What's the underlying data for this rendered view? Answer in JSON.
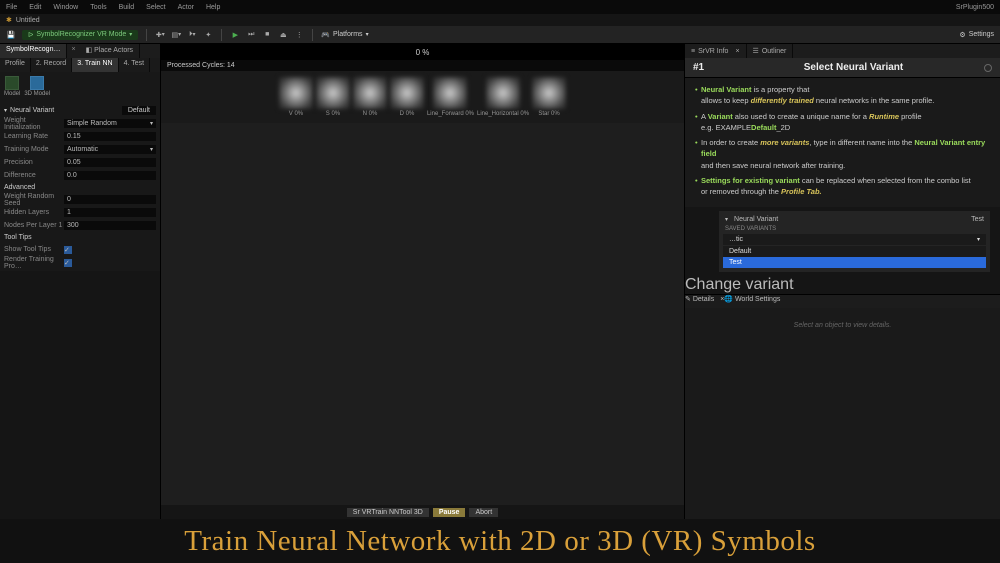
{
  "menubar": [
    "File",
    "Edit",
    "Window",
    "Tools",
    "Build",
    "Select",
    "Actor",
    "Help"
  ],
  "plugin_label": "SrPlugin500",
  "doc_title": "Untitled",
  "mode_label": "SymbolRecognizer VR Mode",
  "platforms_label": "Platforms",
  "settings_label": "Settings",
  "left_tabs": {
    "recog": "SymbolRecogn…",
    "place": "Place Actors"
  },
  "steps": {
    "profile": "Profile",
    "record": "2. Record",
    "train": "3. Train NN",
    "test": "4. Test"
  },
  "models": {
    "a": "Model",
    "b": "3D Model"
  },
  "nv_header": "Neural Variant",
  "nv_value": "Default",
  "props": [
    {
      "label": "Weight Initialization",
      "value": "Simple Random",
      "dd": true
    },
    {
      "label": "Learning Rate",
      "value": "0.15"
    },
    {
      "label": "Training Mode",
      "value": "Automatic",
      "dd": true
    },
    {
      "label": "Precision",
      "value": "0.05"
    },
    {
      "label": "Difference",
      "value": "0.0"
    }
  ],
  "advanced_label": "Advanced",
  "adv_props": [
    {
      "label": "Weight Random Seed",
      "value": "0"
    },
    {
      "label": "Hidden Layers",
      "value": "1"
    },
    {
      "label": "Nodes Per Layer 1",
      "value": "300"
    }
  ],
  "tooltips_label": "Tool Tips",
  "tooltip_rows": [
    {
      "label": "Show Tool Tips",
      "checked": true
    },
    {
      "label": "Render Training Pro…",
      "checked": true
    }
  ],
  "progress": "0 %",
  "processed": "Processed Cycles: 14",
  "symbols": [
    {
      "label": "V 0%"
    },
    {
      "label": "S 0%"
    },
    {
      "label": "N 0%"
    },
    {
      "label": "D 0%"
    },
    {
      "label": "Line_Forward 0%"
    },
    {
      "label": "Line_Horizontal 0%"
    },
    {
      "label": "Star 0%"
    }
  ],
  "bottom_tabs": {
    "tool": "Sr VRTrain NNTool 3D",
    "pause": "Pause",
    "abort": "Abort"
  },
  "right_tabs": {
    "info": "SrVR Info",
    "outliner": "Outliner"
  },
  "info_card": {
    "num": "#1",
    "title": "Select Neural Variant"
  },
  "info_lines": {
    "l1a": "Neural Variant",
    "l1b": " is a property that",
    "l1c": "allows to keep ",
    "l1d": "differently trained",
    "l1e": " neural networks in the same profile.",
    "l2a": "A ",
    "l2b": "Variant",
    "l2c": " also used to create a unique name for a ",
    "l2d": "Runtime",
    "l2e": " profile",
    "l2f": "e.g. EXAMPLE",
    "l2g": "Default",
    "l2h": "_2D",
    "l3a": "In order to create ",
    "l3b": "more variants",
    "l3c": ", type in different name into the ",
    "l3d": "Neural Variant entry field",
    "l3e": "and then save neural network after training.",
    "l4a": "Settings for existing variant",
    "l4b": " can be replaced when selected from the combo list",
    "l4c": "or removed through the ",
    "l4d": "Profile Tab."
  },
  "variant_box": {
    "header_label": "Neural Variant",
    "header_value": "Test",
    "saved_label": "SAVED VARIANTS",
    "dd_value": "…tic",
    "opts": [
      "Default",
      "Test"
    ],
    "tooltip": "Change variant"
  },
  "details_tabs": {
    "details": "Details",
    "world": "World Settings"
  },
  "details_body": "Select an object to view details.",
  "banner": "Train Neural Network with 2D or 3D (VR) Symbols"
}
